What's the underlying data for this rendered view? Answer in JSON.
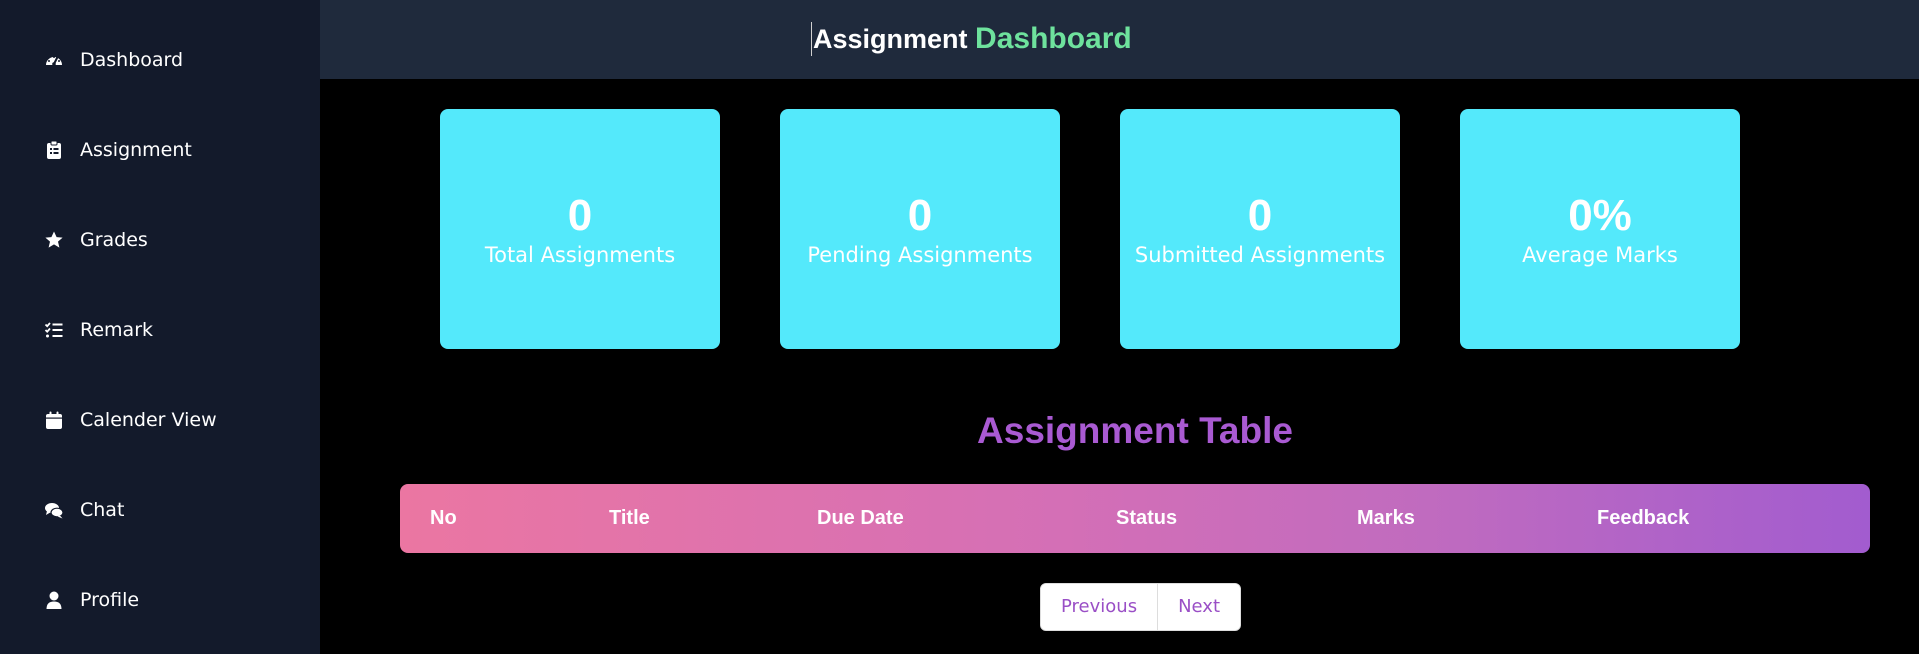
{
  "sidebar": {
    "items": [
      {
        "label": "Dashboard",
        "icon": "gauge-icon"
      },
      {
        "label": "Assignment",
        "icon": "clipboard-icon"
      },
      {
        "label": "Grades",
        "icon": "star-icon"
      },
      {
        "label": "Remark",
        "icon": "checklist-icon"
      },
      {
        "label": "Calender View",
        "icon": "calendar-icon"
      },
      {
        "label": "Chat",
        "icon": "chat-bubbles-icon"
      },
      {
        "label": "Profile",
        "icon": "user-icon"
      }
    ]
  },
  "header": {
    "title_main": "Assignment",
    "title_accent": "Dashboard"
  },
  "stats": [
    {
      "value": "0",
      "label": "Total Assignments"
    },
    {
      "value": "0",
      "label": "Pending Assignments"
    },
    {
      "value": "0",
      "label": "Submitted Assignments"
    },
    {
      "value": "0%",
      "label": "Average Marks"
    }
  ],
  "table": {
    "title": "Assignment Table",
    "columns": [
      "No",
      "Title",
      "Due Date",
      "Status",
      "Marks",
      "Feedback"
    ],
    "rows": []
  },
  "pagination": {
    "previous_label": "Previous",
    "next_label": "Next"
  },
  "colors": {
    "sidebar_bg": "#131a2b",
    "topbar_bg": "#1f2a3c",
    "card_bg": "#54e9fb",
    "accent_green": "#6ee29d",
    "accent_purple": "#a95ad2"
  }
}
